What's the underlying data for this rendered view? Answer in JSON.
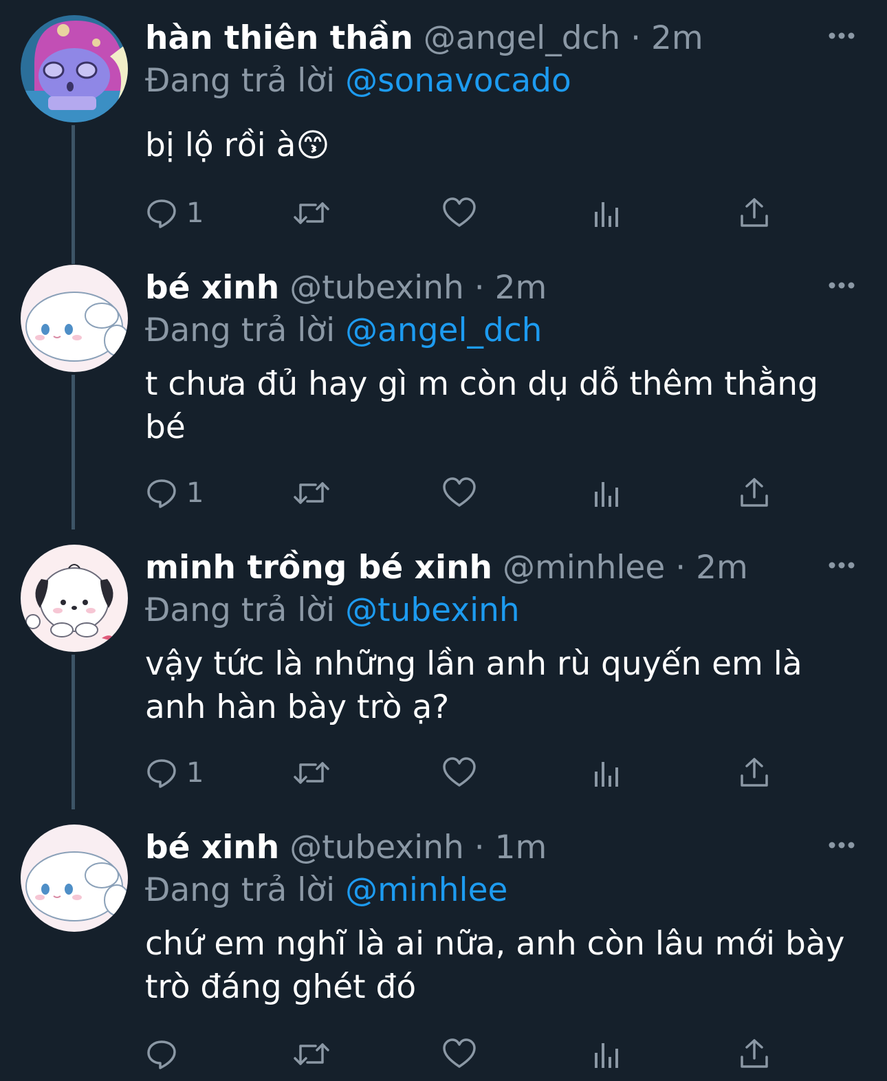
{
  "colors": {
    "background": "#15202b",
    "text_primary": "#ffffff",
    "text_secondary": "#8b98a5",
    "accent": "#1d9bf0",
    "thread_line": "#3d5466"
  },
  "tweets": [
    {
      "name": "hàn thiên thần",
      "handle": "@angel_dch",
      "separator": "·",
      "time": "2m",
      "reply_prefix": "Đang trả lời",
      "reply_to": "@sonavocado",
      "text": "bị lộ rồi à",
      "emoji": "😙",
      "reply_count": "1",
      "avatar_icon": "purple-character-avatar"
    },
    {
      "name": "bé xinh",
      "handle": "@tubexinh",
      "separator": "·",
      "time": "2m",
      "reply_prefix": "Đang trả lời",
      "reply_to": "@angel_dch",
      "text_line1": "t chưa đủ hay gì m còn dụ dỗ thêm thằng",
      "text_line2": "bé",
      "reply_count": "1",
      "avatar_icon": "cinnamoroll-avatar"
    },
    {
      "name": "minh trồng bé xinh",
      "handle": "@minhlee",
      "separator": "·",
      "time": "2m",
      "reply_prefix": "Đang trả lời",
      "reply_to": "@tubexinh",
      "text_line1": "vậy tức là những lần anh rù quyến em là",
      "text_line2": "anh hàn bày trò ạ?",
      "reply_count": "1",
      "avatar_icon": "pochacco-avatar"
    },
    {
      "name": "bé xinh",
      "handle": "@tubexinh",
      "separator": "·",
      "time": "1m",
      "reply_prefix": "Đang trả lời",
      "reply_to": "@minhlee",
      "text_line1": "chứ em nghĩ là ai nữa, anh còn lâu mới bày",
      "text_line2": "trò đáng ghét đó",
      "reply_count": "",
      "avatar_icon": "cinnamoroll-avatar"
    }
  ]
}
